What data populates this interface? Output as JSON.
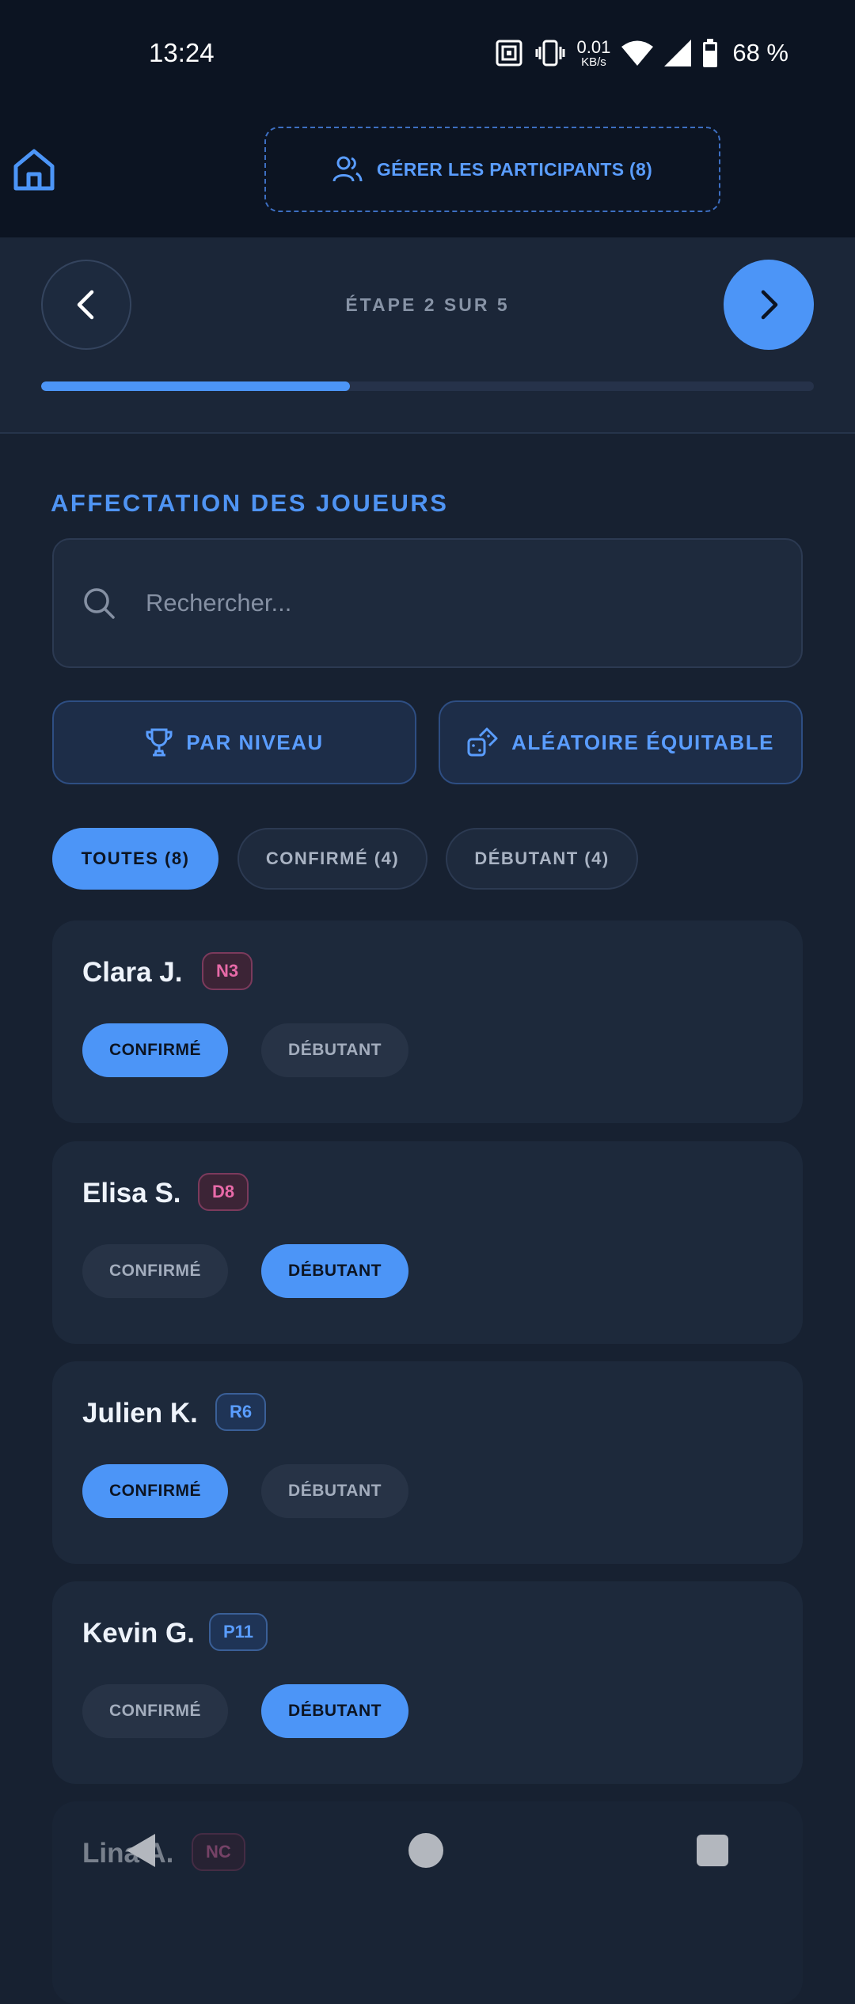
{
  "status_bar": {
    "time": "13:24",
    "net_speed": "0.01",
    "net_unit": "KB/s",
    "battery": "68 %"
  },
  "header": {
    "manage_label": "GÉRER LES PARTICIPANTS (8)"
  },
  "step": {
    "label": "ÉTAPE 2 SUR 5",
    "current": 2,
    "total": 5,
    "progress": 0.4
  },
  "section": {
    "title": "AFFECTATION DES JOUEURS"
  },
  "search": {
    "placeholder": "Rechercher..."
  },
  "actions": {
    "by_level": "PAR NIVEAU",
    "random_fair": "ALÉATOIRE ÉQUITABLE"
  },
  "filters": [
    {
      "label": "TOUTES (8)",
      "active": true
    },
    {
      "label": "CONFIRMÉ (4)",
      "active": false
    },
    {
      "label": "DÉBUTANT (4)",
      "active": false
    }
  ],
  "segment_labels": {
    "confirmed": "CONFIRMÉ",
    "beginner": "DÉBUTANT"
  },
  "players": [
    {
      "name": "Clara J.",
      "level": "N3",
      "badge_color": "pink",
      "selected": "confirmed"
    },
    {
      "name": "Elisa S.",
      "level": "D8",
      "badge_color": "pink",
      "selected": "beginner"
    },
    {
      "name": "Julien K.",
      "level": "R6",
      "badge_color": "blue",
      "selected": "confirmed"
    },
    {
      "name": "Kevin G.",
      "level": "P11",
      "badge_color": "blue",
      "selected": "beginner"
    },
    {
      "name": "Lina A.",
      "level": "NC",
      "badge_color": "pink"
    }
  ],
  "colors": {
    "accent": "#4c95f7",
    "background": "#172131",
    "card": "#1d293b",
    "pink": "#e86aa8"
  }
}
